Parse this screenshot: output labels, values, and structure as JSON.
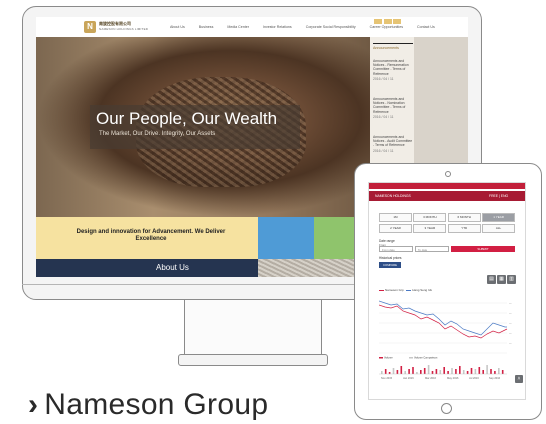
{
  "website": {
    "logo_cn": "南旋控股有限公司",
    "logo_en": "NAMESON HOLDINGS LIMITED",
    "nav": [
      "About Us",
      "Business",
      "Media Center",
      "Investor Relations",
      "Corporate Social Responsibility",
      "Career Opportunities",
      "Contact Us"
    ],
    "hero": {
      "title": "Our People, Our Wealth",
      "subtitle": "The Market, Our Drive. Integrity, Our Assets"
    },
    "sidebar": {
      "subheading": "Announcements",
      "items": [
        {
          "title": "Announcements and Notices - Remuneration Committee - Terms of Reference",
          "date": "2016 / 04 / 11"
        },
        {
          "title": "Announcements and Notices - Nomination Committee - Terms of Reference",
          "date": "2016 / 04 / 11"
        },
        {
          "title": "Announcements and Notices - Audit Committee - Terms of Reference",
          "date": "2016 / 04 / 11"
        },
        {
          "title": "Announcements and Notices - List of Directors",
          "date": ""
        }
      ]
    },
    "band_text": "Design and innovation for Advancement. We Deliver Excellence",
    "about_label": "About Us"
  },
  "tablet": {
    "header_left": "NAMESON HOLDINGS",
    "header_right": "FREE | ENG",
    "periods": [
      "1M",
      "3 MONTH",
      "6 MONTH",
      "1 YEAR",
      "2 YEAR",
      "3 YEAR",
      "YTD",
      "ALL"
    ],
    "active_period": "1 YEAR",
    "range_label": "Date range",
    "range_sub": "From",
    "from_placeholder": "From date",
    "to_placeholder": "To date",
    "submit_label": "SUBMIT",
    "comparison_label": "Historical prices",
    "comparison_button": "COMPARE",
    "legend": [
      "Nameson Grp",
      "Hang Seng Idx"
    ],
    "volume_legend": [
      "Volume",
      "Volume Comparison"
    ],
    "x_ticks": [
      "Nov 2015",
      "Jan 2016",
      "Mar 2016",
      "May 2016",
      "Jul 2016",
      "Sep 2016"
    ],
    "colors": {
      "primary": "#c21f3a",
      "dark": "#2d4e87"
    }
  },
  "caption": {
    "chevron": "›",
    "text": "Nameson Group"
  }
}
